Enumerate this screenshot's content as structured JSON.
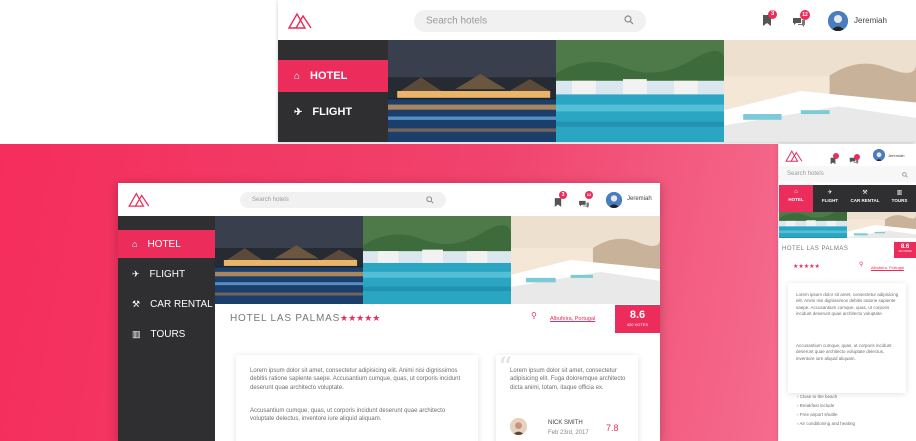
{
  "search": {
    "placeholder": "Search hotels"
  },
  "user": {
    "name": "Jeremiah"
  },
  "badges": {
    "bookings": "3",
    "messages": "12"
  },
  "nav": {
    "hotel": "HOTEL",
    "flight": "FLIGHT",
    "car": "CAR RENTAL",
    "tours": "TOURS"
  },
  "hotel": {
    "name": "HOTEL LAS PALMAS",
    "stars": "★★★★★",
    "location": "Albufeira, Portugal",
    "score": "8.6",
    "votes": "420 VOTES"
  },
  "description": {
    "p1": "Lorem ipsum dolor sit amet, consectetur adipisicing elit. Animi nisi dignissimos debitis ratione sapiente saepe. Accusantium cumque, quas, ut corporis incidunt deserunt quae architecto voluptate.",
    "p2": "Accusantium cumque, quas, ut corporis incidunt deserunt quae architecto voluptate delectus, inventore iure aliquid aliquam."
  },
  "review": {
    "text": "Lorem ipsum dolor sit amet, consectetur adipisicing elit. Fuga doloremque architecto dicta animi, totam, itaque officia ex.",
    "author": "NICK SMITH",
    "date": "Feb 23rd, 2017",
    "score": "7.8"
  },
  "mobile": {
    "score_label": "420 VOTES",
    "p1": "Lorem ipsum dolor sit amet, consectetur adipisicing elit. Animi nisi dignissimos debitis ratione sapiente saepe. Accusantium cumque, quas, ut corporis incidunt deserunt quae architecto voluptate.",
    "p2": "Accusantium cumque, quas, ut corporis incidunt deserunt quae architecto voluptate delectus, inventore iure aliquid aliquam.",
    "features": [
      "Close to the beach",
      "Breakfast include",
      "Free airport shuttle",
      "Air conditioning and heating"
    ]
  },
  "colors": {
    "accent": "#ec2c5b",
    "sidebar": "#2f2f31"
  }
}
